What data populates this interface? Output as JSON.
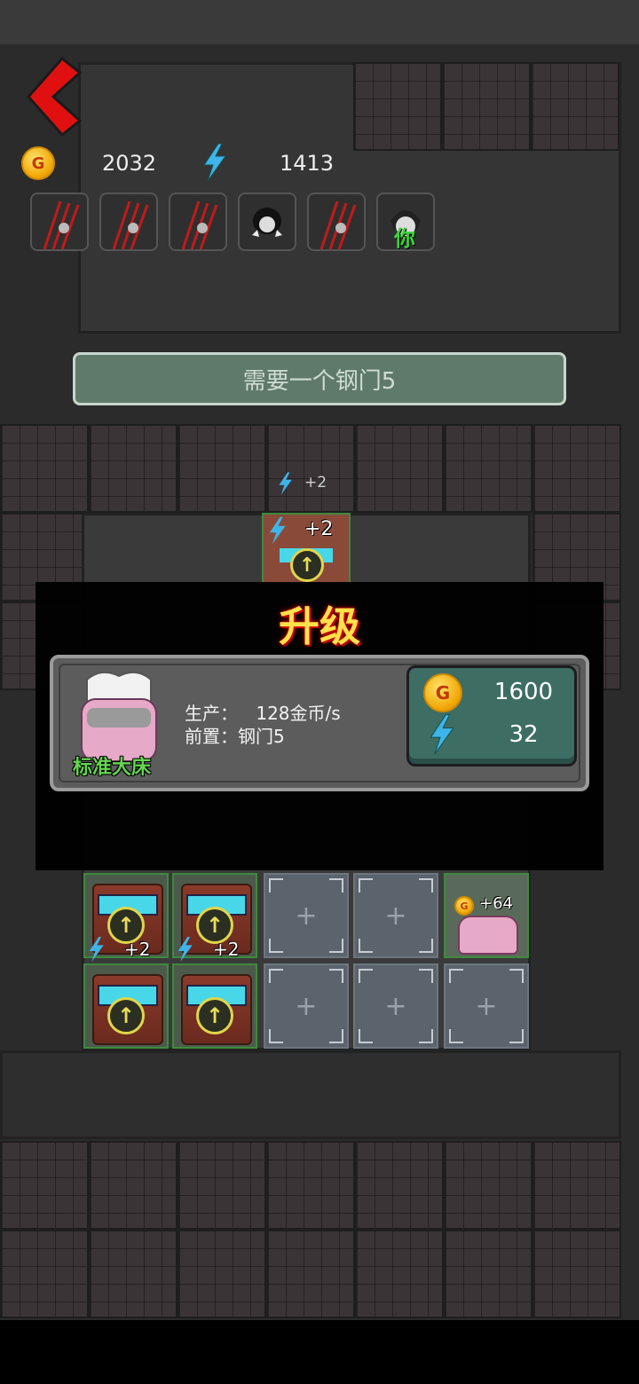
{
  "hud": {
    "gold": "2032",
    "energy": "1413",
    "slots": [
      "claw-icon",
      "claw-icon",
      "claw-icon",
      "ghost-girl-icon",
      "claw-icon",
      "you-avatar-icon"
    ],
    "you_label": "你"
  },
  "requirement_banner": "需要一个钢门5",
  "door_bonus": {
    "small": "+2",
    "tile": "+2"
  },
  "upgrade_dialog": {
    "title": "升级",
    "item_name": "标准大床",
    "production_label": "生产：",
    "production_value": "128金币/s",
    "prereq_label": "前置：",
    "prereq_value": "钢门5",
    "cost_gold": "1600",
    "cost_energy": "32"
  },
  "grid": {
    "row1": [
      "+2",
      "+2",
      "+",
      "+",
      "+64"
    ],
    "row2": [
      "",
      "",
      "+",
      "+",
      "+"
    ],
    "bed_coin_label": "G",
    "bed_bonus": "+64",
    "machine_bonus": "+2",
    "hidden_labels": [
      "+2",
      "+2",
      "+64"
    ]
  },
  "coin_symbol": "G",
  "colors": {
    "accent_red": "#e01010",
    "energy_blue": "#2fa8e0",
    "banner_green": "#5f7a6a",
    "cost_button": "#3e6d64"
  }
}
